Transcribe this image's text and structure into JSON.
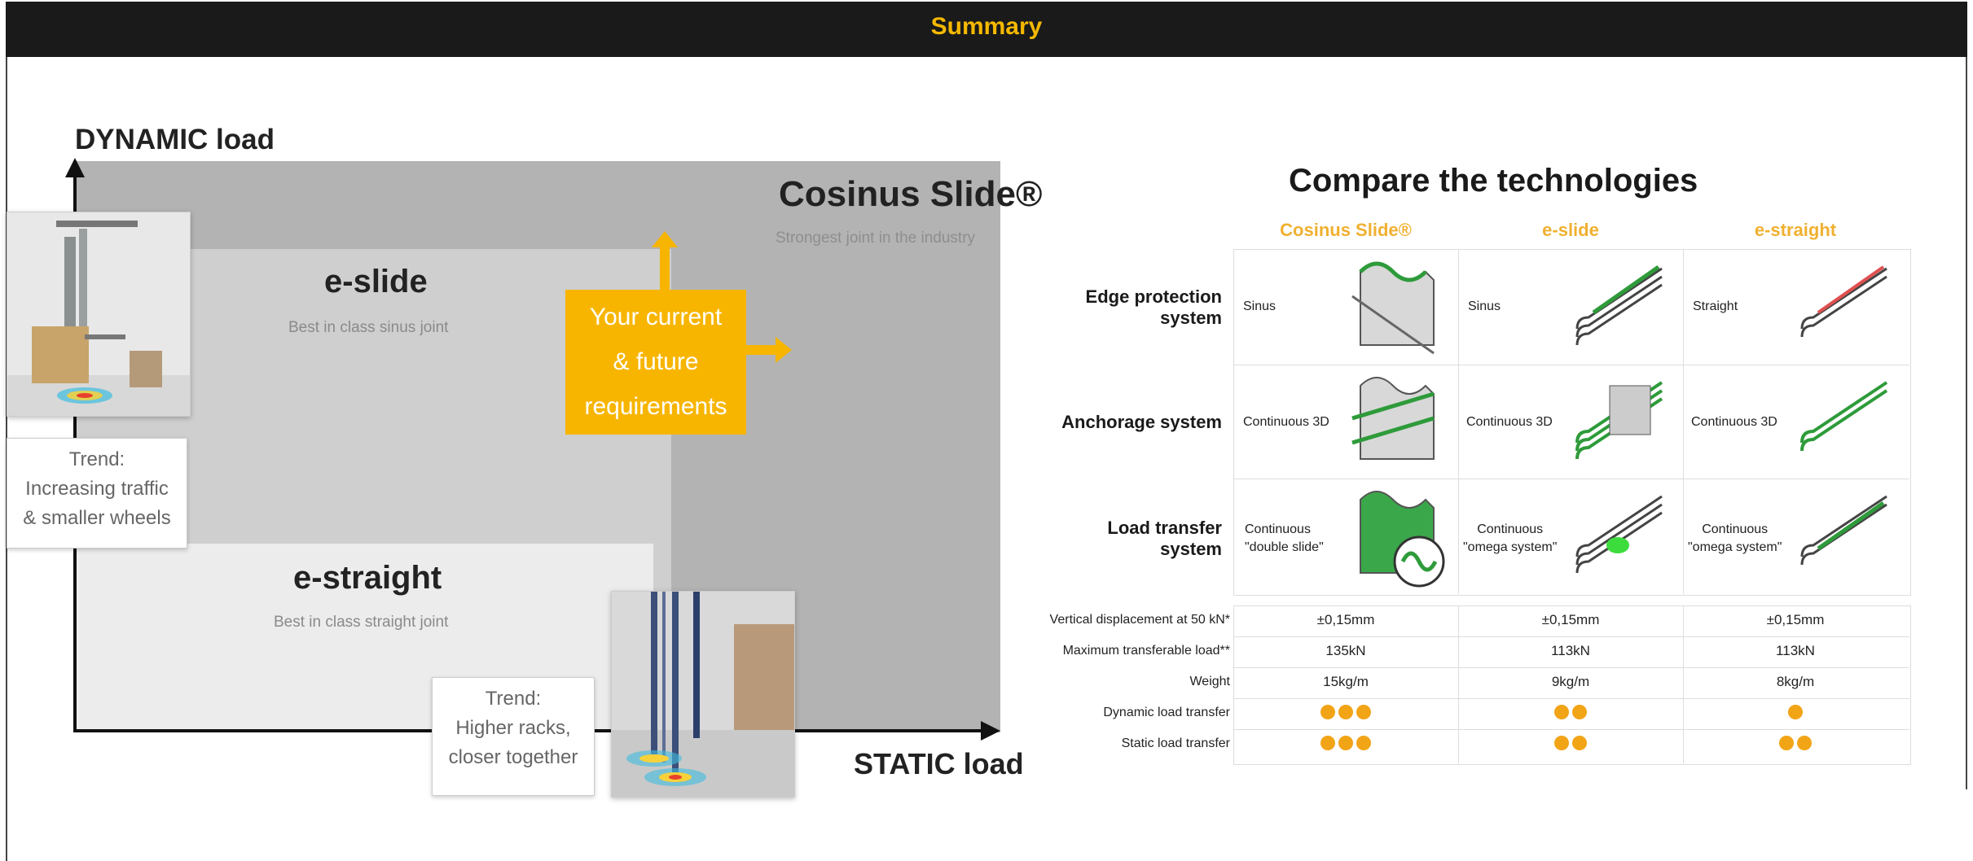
{
  "header": {
    "title": "Summary"
  },
  "diagram": {
    "y_axis_label": "DYNAMIC load",
    "x_axis_label": "STATIC load",
    "zones": [
      {
        "title": "Cosinus Slide®",
        "subtitle": "Strongest joint in the industry"
      },
      {
        "title": "e-slide",
        "subtitle": "Best in class sinus joint"
      },
      {
        "title": "e-straight",
        "subtitle": "Best in class straight joint"
      }
    ],
    "requirements_box": [
      "Your current",
      "& future",
      "requirements"
    ],
    "trend_traffic": [
      "Trend:",
      "Increasing traffic",
      "& smaller wheels"
    ],
    "trend_racks": [
      "Trend:",
      "Higher racks,",
      "closer together"
    ],
    "colors": {
      "accent": "#f7b500",
      "zone_dark": "#b3b3b3",
      "zone_mid": "#cfcfcf",
      "zone_light": "#ececec"
    }
  },
  "comparison": {
    "title": "Compare the technologies",
    "columns": [
      "Cosinus Slide®",
      "e-slide",
      "e-straight"
    ],
    "rows": [
      {
        "label": [
          "Edge protection",
          "system"
        ],
        "cells": [
          [
            "Sinus"
          ],
          [
            "Sinus"
          ],
          [
            "Straight"
          ]
        ]
      },
      {
        "label": [
          "Anchorage system"
        ],
        "cells": [
          [
            "Continuous 3D"
          ],
          [
            "Continuous 3D"
          ],
          [
            "Continuous 3D"
          ]
        ]
      },
      {
        "label": [
          "Load transfer",
          "system"
        ],
        "cells": [
          [
            "Continuous",
            "\"double slide\""
          ],
          [
            "Continuous",
            "\"omega system\""
          ],
          [
            "Continuous",
            "\"omega system\""
          ]
        ]
      }
    ],
    "specs": [
      {
        "label": "Vertical displacement at 50 kN*",
        "values": [
          "±0,15mm",
          "±0,15mm",
          "±0,15mm"
        ]
      },
      {
        "label": "Maximum transferable load**",
        "values": [
          "135kN",
          "113kN",
          "113kN"
        ]
      },
      {
        "label": "Weight",
        "values": [
          "15kg/m",
          "9kg/m",
          "8kg/m"
        ]
      }
    ],
    "ratings": [
      {
        "label": "Dynamic load transfer",
        "values": [
          3,
          2,
          1
        ]
      },
      {
        "label": "Static load transfer",
        "values": [
          3,
          2,
          2
        ]
      }
    ],
    "colors": {
      "column_header": "#f0b030",
      "rating_dot": "#f2a417"
    }
  }
}
